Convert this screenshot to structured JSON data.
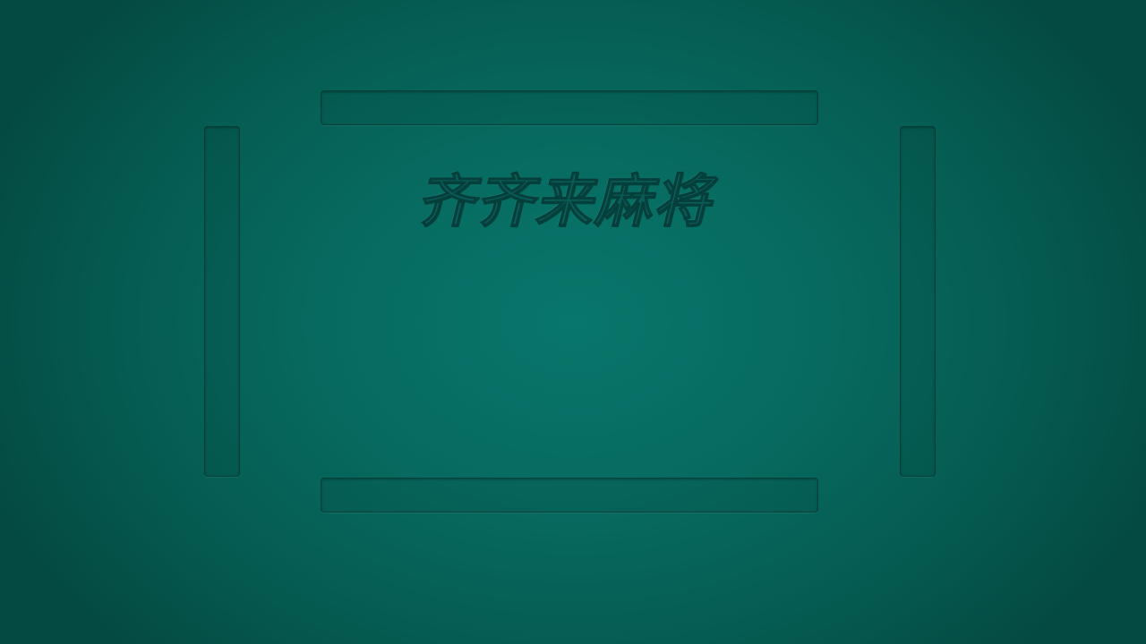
{
  "game": {
    "title": "齐齐来麻将"
  },
  "colors": {
    "table_center": "#08766b",
    "table_edge": "#044a42",
    "title_fill": "#0a5d58",
    "title_outline": "#053f3c"
  },
  "seats": {
    "top": {
      "tiles": []
    },
    "bottom": {
      "tiles": []
    },
    "left": {
      "tiles": []
    },
    "right": {
      "tiles": []
    }
  }
}
